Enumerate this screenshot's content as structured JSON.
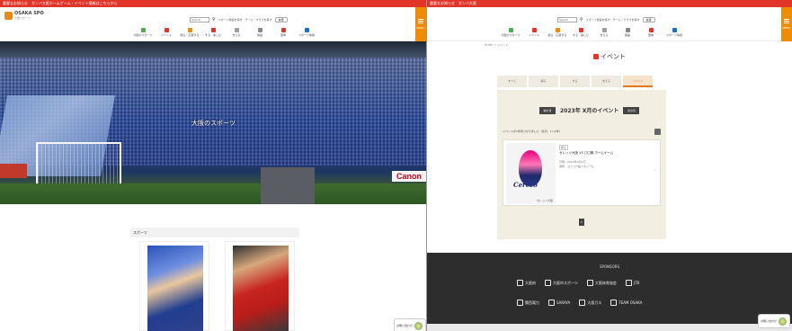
{
  "left": {
    "topbar": "重要なお知らせ　ガンバ大阪ホームゲーム・イベント情報はこちらから",
    "logo": {
      "name": "OSAKA SPO",
      "sub": "大阪スポーツ"
    },
    "search": {
      "placeholder": "Search",
      "icon": "search-icon"
    },
    "header_links": [
      "スポーツ施設を探す",
      "チーム・クラブを探す"
    ],
    "lang_label": "言語",
    "nav": [
      {
        "label": "大阪のスポーツ",
        "color": "#4caf50"
      },
      {
        "label": "イベント",
        "color": "#e1352a"
      },
      {
        "label": "観る・応援する",
        "color": "#f08c00"
      },
      {
        "label": "する・楽しむ",
        "color": "#e1352a"
      },
      {
        "label": "支える",
        "color": "#9e9e9e"
      },
      {
        "label": "施設",
        "color": "#888888"
      },
      {
        "label": "団体",
        "color": "#e1352a"
      },
      {
        "label": "スポーツ情報",
        "color": "#1e6fc7"
      }
    ],
    "menu_label": "MENU",
    "hero": {
      "title": "大阪のスポーツ",
      "banner": "Canon"
    },
    "section_title": "スポーツ",
    "cards": [
      {
        "alt": "rugby-player-blue"
      },
      {
        "alt": "rugby-player-red"
      }
    ],
    "chat": "お問い合わせ"
  },
  "right": {
    "topbar": "重要なお知らせ　ガンバ大阪",
    "search": {
      "placeholder": "Search"
    },
    "header_links": [
      "スポーツ施設を探す",
      "チーム・クラブを探す"
    ],
    "lang_label": "言語",
    "nav": [
      {
        "label": "大阪のスポーツ",
        "color": "#4caf50"
      },
      {
        "label": "イベント",
        "color": "#e1352a"
      },
      {
        "label": "観る・応援する",
        "color": "#f08c00"
      },
      {
        "label": "する・楽しむ",
        "color": "#e1352a"
      },
      {
        "label": "支える",
        "color": "#9e9e9e"
      },
      {
        "label": "施設",
        "color": "#888888"
      },
      {
        "label": "団体",
        "color": "#e1352a"
      },
      {
        "label": "スポーツ情報",
        "color": "#1e6fc7"
      }
    ],
    "menu_label": "MENU",
    "breadcrumb": "HOME ＞ イベント",
    "page_title": "イベント",
    "tabs": [
      {
        "label": "すべて",
        "active": false
      },
      {
        "label": "観る",
        "active": false
      },
      {
        "label": "する",
        "active": false
      },
      {
        "label": "支える",
        "active": false
      },
      {
        "label": "イベント",
        "active": true
      }
    ],
    "month": {
      "prev": "前の月",
      "title": "2023年 X月のイベント",
      "next": "次の月"
    },
    "count_text": "イベントが1件見つかりました（表示：1〜1件）",
    "event": {
      "tag": "観る",
      "title": "セレッソ大阪 VS 〇〇戦 ホームゲーム",
      "meta1": "日時：2023年X月X日",
      "meta2": "場所：ヨドコウ桜スタジアム",
      "thumb_word": "Cerezo",
      "thumb_caption": "セレッソ大阪"
    },
    "page_num": "1",
    "footer": {
      "title": "SPONSORS",
      "row1": [
        "大阪府",
        "大阪市スポーツ",
        "大阪体育協会",
        "JTB"
      ],
      "row2": [
        "関西電力",
        "SARAYA",
        "大阪ガス",
        "TEAM OSAKA"
      ]
    },
    "chat": "お問い合わせ"
  }
}
